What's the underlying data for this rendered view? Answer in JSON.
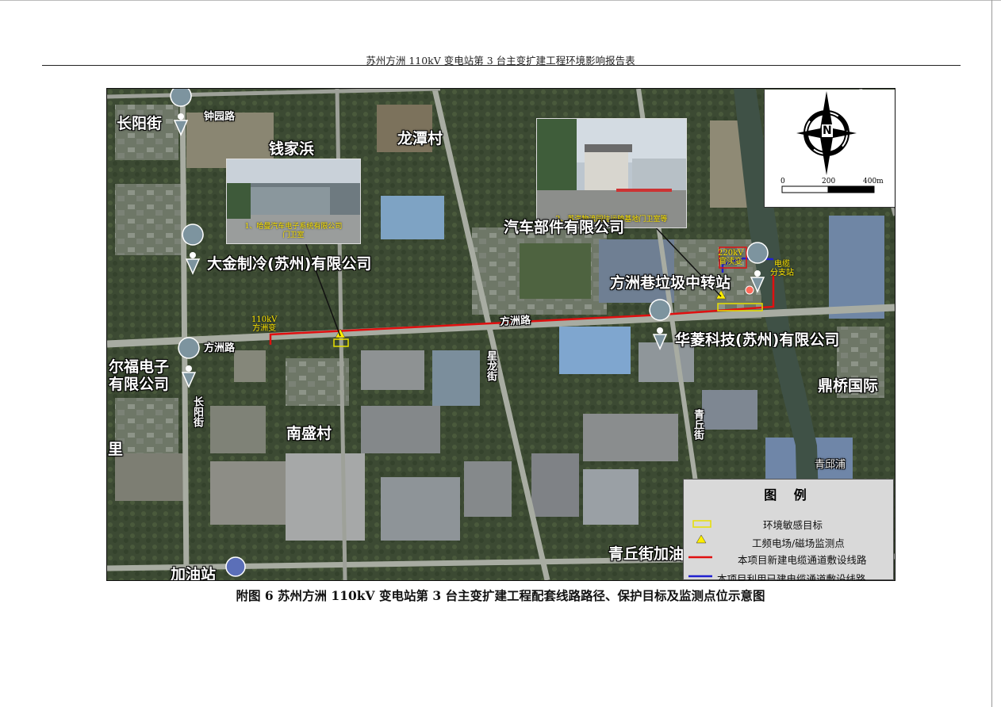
{
  "header": {
    "title": "苏州方洲 110kV 变电站第 3 台主变扩建工程环境影响报告表"
  },
  "map": {
    "place_labels": {
      "changyang_jie_top": "长阳街",
      "zhongyuan_lu": "钟园路",
      "qianjiabang": "钱家浜",
      "longtan_cun": "龙潭村",
      "daikin": "大金制冷(苏州)有限公司",
      "automotive_parts": "汽车部件有限公司",
      "fangzhou_transfer": "方洲巷垃圾中转站",
      "fangzhou_lu_center": "方洲路",
      "fangzhou_lu_left": "方洲路",
      "xinglong_jie": "星龙街",
      "huaxia_tech": "华菱科技(苏州)有限公司",
      "erfu_electronics": "尔福电子\n有限公司",
      "changyang_jie_vertical": "长阳街",
      "nansheng_cun": "南盛村",
      "li": "里",
      "qingqiu_jie": "青丘街",
      "dingqiao": "鼎桥国际",
      "qingqiupu": "青邱浦",
      "qingqiu_gas": "青丘街加油",
      "gas_station": "加油站"
    },
    "annotations": {
      "substation_110kv": "110kV\n方洲变",
      "substation_220kv": "220kV\n官渎变",
      "cable_branch": "电缆\n分支站"
    },
    "photos": [
      {
        "caption": "1、哈曼汽车电子系统有限公司\n门卫室"
      },
      {
        "caption": "2、苏汽物流园往运输基地门卫室等"
      }
    ],
    "scale": {
      "labels": [
        "0",
        "200",
        "400m"
      ]
    },
    "compass_letter": "N"
  },
  "legend": {
    "title": "图 例",
    "items": [
      {
        "label": "环境敏感目标",
        "color": "#e8e000"
      },
      {
        "label": "工频电场/磁场监测点",
        "color": "#ffee00"
      },
      {
        "label": "本项目新建电缆通道敷设线路",
        "color": "#e01010"
      },
      {
        "label": "本项目利用已建电缆通道敷设线路",
        "color": "#2020d0"
      }
    ]
  },
  "caption": "附图 6  苏州方洲 110kV 变电站第 3 台主变扩建工程配套线路路径、保护目标及监测点位示意图"
}
